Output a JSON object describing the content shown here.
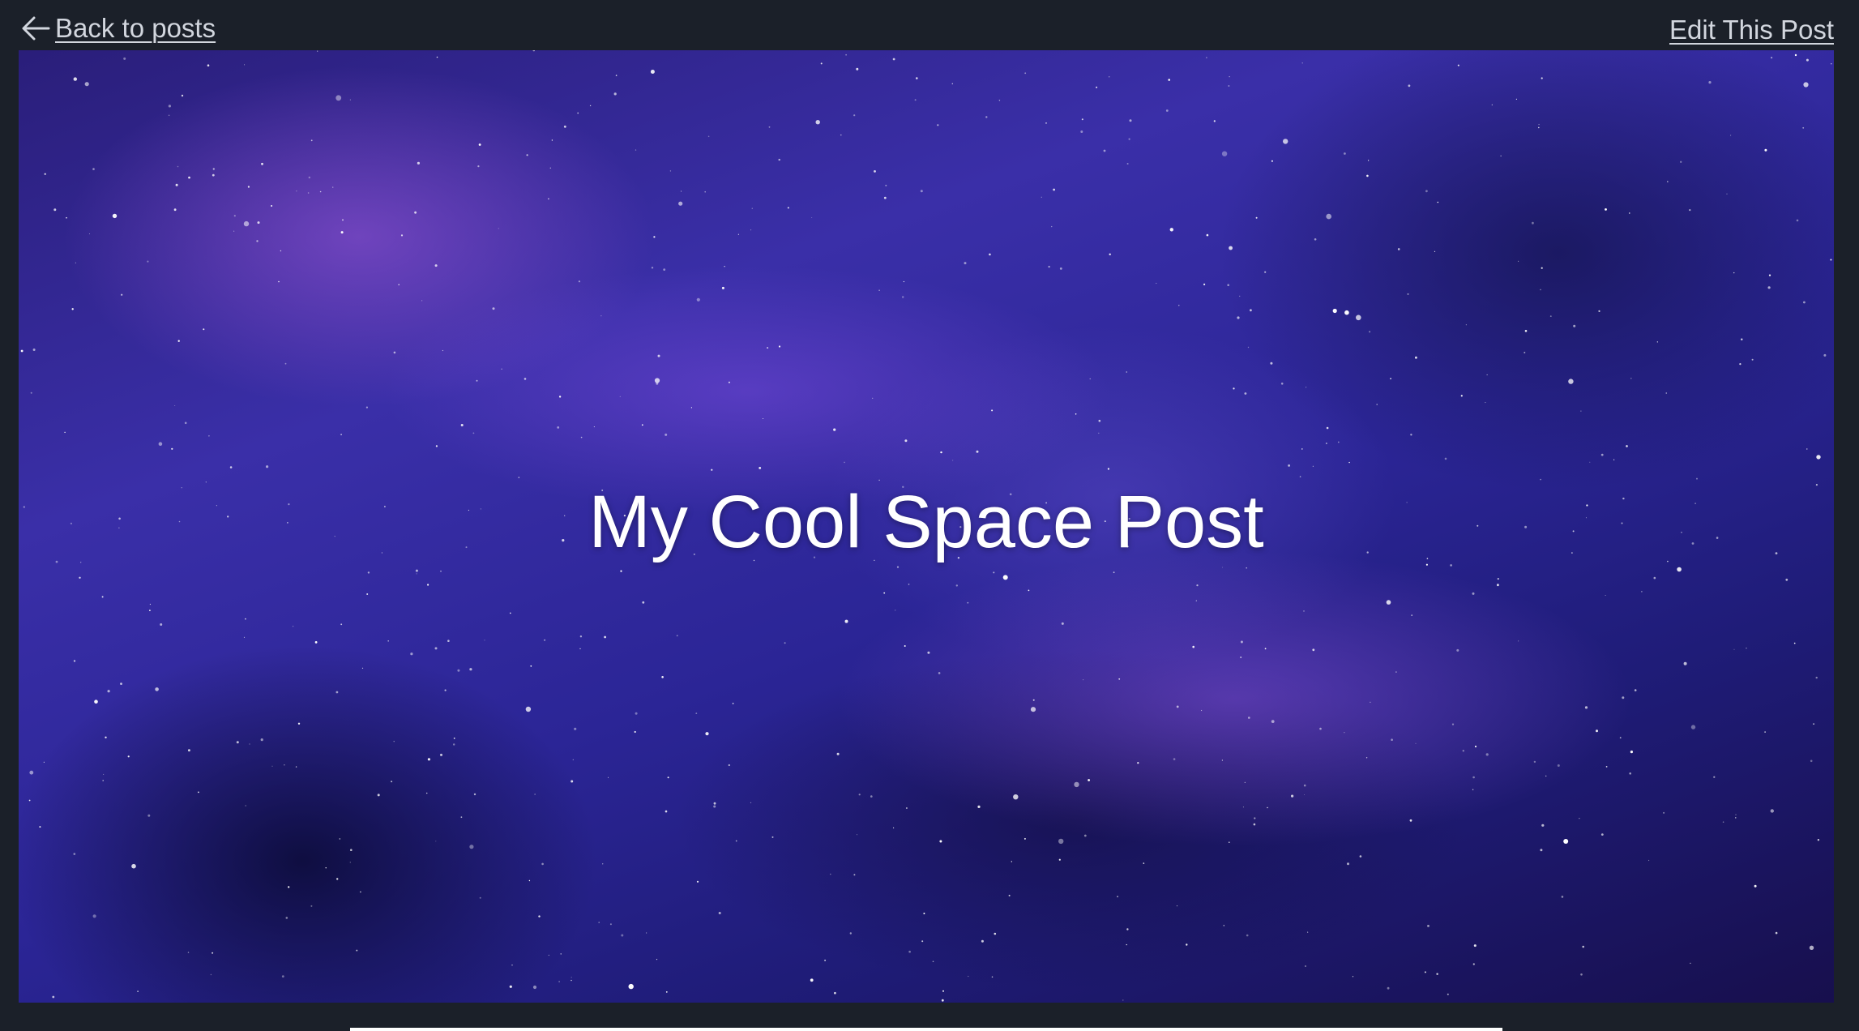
{
  "nav": {
    "back_label": "Back to posts",
    "back_icon": "arrow-left-icon",
    "edit_label": "Edit This Post"
  },
  "post": {
    "title": "My Cool Space Post",
    "hero_image": "space-nebula-image"
  },
  "colors": {
    "page_background": "#1b2029",
    "link_text": "#d2d6de",
    "title_text": "#ffffff"
  }
}
